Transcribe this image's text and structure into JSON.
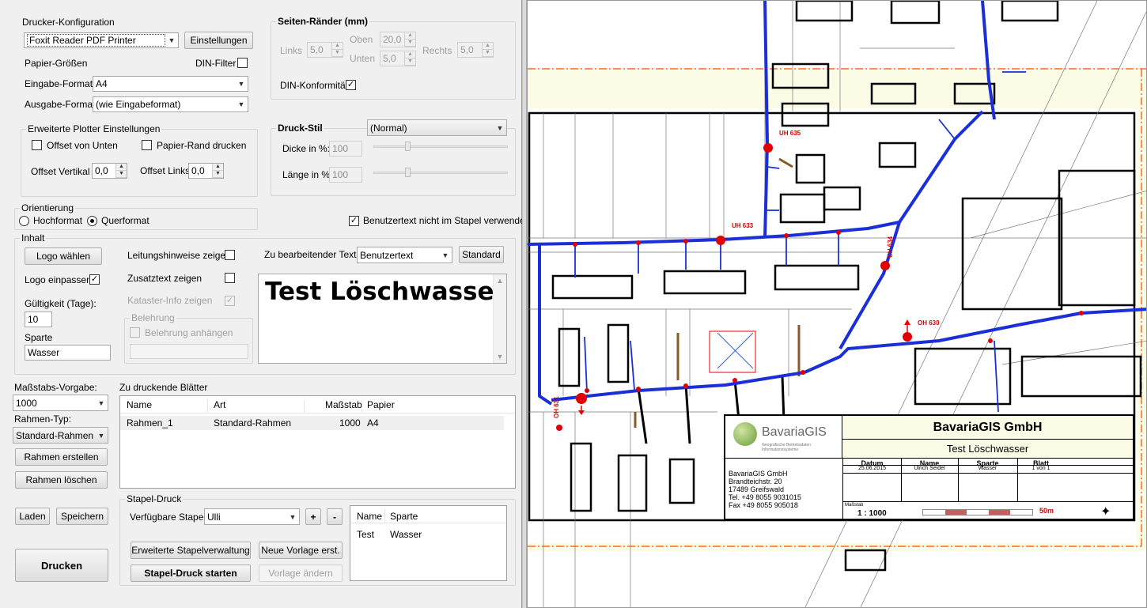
{
  "printer": {
    "group_title": "Drucker-Konfiguration",
    "printer_name": "Foxit Reader PDF Printer",
    "settings_button": "Einstellungen",
    "paper_sizes_label": "Papier-Größen",
    "din_filter_label": "DIN-Filter",
    "din_filter_checked": false,
    "input_format_label": "Eingabe-Format:",
    "input_format_value": "A4",
    "output_format_label": "Ausgabe-Format:",
    "output_format_value": "(wie Eingabeformat)"
  },
  "plotter": {
    "group_title": "Erweiterte Plotter Einstellungen",
    "offset_bottom_label": "Offset von Unten",
    "offset_bottom_checked": false,
    "paper_border_label": "Papier-Rand drucken",
    "paper_border_checked": false,
    "offset_vertical_label": "Offset Vertikal",
    "offset_vertical_value": "0,0",
    "offset_left_label": "Offset Links",
    "offset_left_value": "0,0"
  },
  "margins": {
    "group_title": "Seiten-Ränder (mm)",
    "left_label": "Links",
    "left_value": "5,0",
    "top_label": "Oben",
    "top_value": "20,0",
    "bottom_label": "Unten",
    "bottom_value": "5,0",
    "right_label": "Rechts",
    "right_value": "5,0",
    "din_conformity_label": "DIN-Konformität",
    "din_conformity_checked": true
  },
  "print_style": {
    "group_title": "Druck-Stil",
    "style_value": "(Normal)",
    "thickness_label": "Dicke in %:",
    "thickness_value": "100",
    "length_label": "Länge in %:",
    "length_value": "100"
  },
  "orientation": {
    "group_title": "Orientierung",
    "portrait_label": "Hochformat",
    "landscape_label": "Querformat",
    "selected": "Querformat"
  },
  "user_text_not_in_batch": {
    "label": "Benutzertext nicht im Stapel verwenden",
    "checked": true
  },
  "content": {
    "group_title": "Inhalt",
    "choose_logo_button": "Logo wählen",
    "fit_logo_label": "Logo einpassen",
    "fit_logo_checked": true,
    "validity_label": "Gültigkeit (Tage):",
    "validity_value": "10",
    "division_label": "Sparte",
    "division_value": "Wasser",
    "show_line_hints_label": "Leitungshinweise zeigen",
    "show_line_hints_checked": false,
    "show_additional_text_label": "Zusatztext zeigen",
    "show_additional_text_checked": false,
    "show_cadastre_label": "Kataster-Info zeigen",
    "show_cadastre_checked": true,
    "instruction_group_title": "Belehrung",
    "attach_instruction_label": "Belehrung anhängen",
    "attach_instruction_checked": false,
    "text_to_edit_label": "Zu bearbeitender Text:",
    "text_to_edit_value": "Benutzertext",
    "standard_button": "Standard",
    "edit_text": "Test Löschwasser"
  },
  "scale": {
    "preset_label": "Maßstabs-Vorgabe:",
    "preset_value": "1000",
    "frame_type_label": "Rahmen-Typ:",
    "frame_type_value": "Standard-Rahmen",
    "create_frame_button": "Rahmen erstellen",
    "delete_frame_button": "Rahmen löschen"
  },
  "sheets": {
    "label": "Zu druckende Blätter",
    "columns": [
      "Name",
      "Art",
      "Maßstab",
      "Papier"
    ],
    "rows": [
      {
        "name": "Rahmen_1",
        "type": "Standard-Rahmen",
        "scale": "1000",
        "paper": "A4"
      }
    ]
  },
  "batch": {
    "group_title": "Stapel-Druck",
    "available_label": "Verfügbare Stapel",
    "available_value": "Ulli",
    "add_button": "+",
    "remove_button": "-",
    "advanced_button": "Erweiterte Stapelverwaltung",
    "new_template_button": "Neue Vorlage erst.",
    "start_button": "Stapel-Druck starten",
    "change_template_button": "Vorlage ändern",
    "columns": [
      "Name",
      "Sparte"
    ],
    "rows": [
      {
        "name": "Test",
        "division": "Wasser"
      }
    ]
  },
  "actions": {
    "load_button": "Laden",
    "save_button": "Speichern",
    "print_button": "Drucken"
  },
  "map": {
    "hydrant_labels": [
      "UH 635",
      "UH 633",
      "UH 634",
      "OH 630",
      "OH 631"
    ],
    "title_block": {
      "logo_text": "BavariaGIS",
      "logo_subtext": "Geografische Betriebsdaten Informationssysteme",
      "company": "BavariaGIS GmbH",
      "title": "Test Löschwasser",
      "address_lines": [
        "BavariaGIS GmbH",
        "Brandteichstr. 20",
        "17489 Greifswald",
        "Tel. +49 8055 9031015",
        "Fax +49 8055 905018"
      ],
      "headers": [
        "Datum",
        "Name",
        "Sparte",
        "Blatt"
      ],
      "values": [
        "25.06.2015",
        "Ulrich Seidel",
        "Wasser",
        "1 von 1"
      ],
      "scale_caption": "Maßstab",
      "scale_value": "1 : 1000",
      "scalebar_label": "50m"
    },
    "colors": {
      "water_line": "#1a2fd8",
      "hydrant": "#e00000",
      "frame_dash": "#ff6a1a",
      "building": "#000000"
    }
  }
}
